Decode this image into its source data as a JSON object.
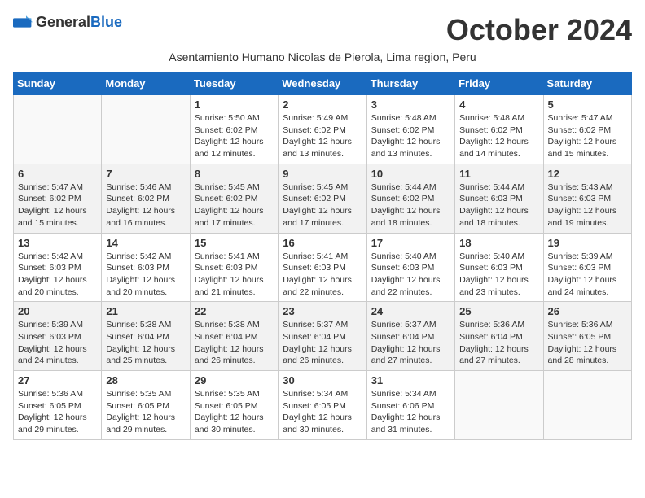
{
  "logo": {
    "general": "General",
    "blue": "Blue"
  },
  "title": "October 2024",
  "subtitle": "Asentamiento Humano Nicolas de Pierola, Lima region, Peru",
  "weekdays": [
    "Sunday",
    "Monday",
    "Tuesday",
    "Wednesday",
    "Thursday",
    "Friday",
    "Saturday"
  ],
  "weeks": [
    [
      {
        "day": "",
        "info": ""
      },
      {
        "day": "",
        "info": ""
      },
      {
        "day": "1",
        "info": "Sunrise: 5:50 AM\nSunset: 6:02 PM\nDaylight: 12 hours and 12 minutes."
      },
      {
        "day": "2",
        "info": "Sunrise: 5:49 AM\nSunset: 6:02 PM\nDaylight: 12 hours and 13 minutes."
      },
      {
        "day": "3",
        "info": "Sunrise: 5:48 AM\nSunset: 6:02 PM\nDaylight: 12 hours and 13 minutes."
      },
      {
        "day": "4",
        "info": "Sunrise: 5:48 AM\nSunset: 6:02 PM\nDaylight: 12 hours and 14 minutes."
      },
      {
        "day": "5",
        "info": "Sunrise: 5:47 AM\nSunset: 6:02 PM\nDaylight: 12 hours and 15 minutes."
      }
    ],
    [
      {
        "day": "6",
        "info": "Sunrise: 5:47 AM\nSunset: 6:02 PM\nDaylight: 12 hours and 15 minutes."
      },
      {
        "day": "7",
        "info": "Sunrise: 5:46 AM\nSunset: 6:02 PM\nDaylight: 12 hours and 16 minutes."
      },
      {
        "day": "8",
        "info": "Sunrise: 5:45 AM\nSunset: 6:02 PM\nDaylight: 12 hours and 17 minutes."
      },
      {
        "day": "9",
        "info": "Sunrise: 5:45 AM\nSunset: 6:02 PM\nDaylight: 12 hours and 17 minutes."
      },
      {
        "day": "10",
        "info": "Sunrise: 5:44 AM\nSunset: 6:02 PM\nDaylight: 12 hours and 18 minutes."
      },
      {
        "day": "11",
        "info": "Sunrise: 5:44 AM\nSunset: 6:03 PM\nDaylight: 12 hours and 18 minutes."
      },
      {
        "day": "12",
        "info": "Sunrise: 5:43 AM\nSunset: 6:03 PM\nDaylight: 12 hours and 19 minutes."
      }
    ],
    [
      {
        "day": "13",
        "info": "Sunrise: 5:42 AM\nSunset: 6:03 PM\nDaylight: 12 hours and 20 minutes."
      },
      {
        "day": "14",
        "info": "Sunrise: 5:42 AM\nSunset: 6:03 PM\nDaylight: 12 hours and 20 minutes."
      },
      {
        "day": "15",
        "info": "Sunrise: 5:41 AM\nSunset: 6:03 PM\nDaylight: 12 hours and 21 minutes."
      },
      {
        "day": "16",
        "info": "Sunrise: 5:41 AM\nSunset: 6:03 PM\nDaylight: 12 hours and 22 minutes."
      },
      {
        "day": "17",
        "info": "Sunrise: 5:40 AM\nSunset: 6:03 PM\nDaylight: 12 hours and 22 minutes."
      },
      {
        "day": "18",
        "info": "Sunrise: 5:40 AM\nSunset: 6:03 PM\nDaylight: 12 hours and 23 minutes."
      },
      {
        "day": "19",
        "info": "Sunrise: 5:39 AM\nSunset: 6:03 PM\nDaylight: 12 hours and 24 minutes."
      }
    ],
    [
      {
        "day": "20",
        "info": "Sunrise: 5:39 AM\nSunset: 6:03 PM\nDaylight: 12 hours and 24 minutes."
      },
      {
        "day": "21",
        "info": "Sunrise: 5:38 AM\nSunset: 6:04 PM\nDaylight: 12 hours and 25 minutes."
      },
      {
        "day": "22",
        "info": "Sunrise: 5:38 AM\nSunset: 6:04 PM\nDaylight: 12 hours and 26 minutes."
      },
      {
        "day": "23",
        "info": "Sunrise: 5:37 AM\nSunset: 6:04 PM\nDaylight: 12 hours and 26 minutes."
      },
      {
        "day": "24",
        "info": "Sunrise: 5:37 AM\nSunset: 6:04 PM\nDaylight: 12 hours and 27 minutes."
      },
      {
        "day": "25",
        "info": "Sunrise: 5:36 AM\nSunset: 6:04 PM\nDaylight: 12 hours and 27 minutes."
      },
      {
        "day": "26",
        "info": "Sunrise: 5:36 AM\nSunset: 6:05 PM\nDaylight: 12 hours and 28 minutes."
      }
    ],
    [
      {
        "day": "27",
        "info": "Sunrise: 5:36 AM\nSunset: 6:05 PM\nDaylight: 12 hours and 29 minutes."
      },
      {
        "day": "28",
        "info": "Sunrise: 5:35 AM\nSunset: 6:05 PM\nDaylight: 12 hours and 29 minutes."
      },
      {
        "day": "29",
        "info": "Sunrise: 5:35 AM\nSunset: 6:05 PM\nDaylight: 12 hours and 30 minutes."
      },
      {
        "day": "30",
        "info": "Sunrise: 5:34 AM\nSunset: 6:05 PM\nDaylight: 12 hours and 30 minutes."
      },
      {
        "day": "31",
        "info": "Sunrise: 5:34 AM\nSunset: 6:06 PM\nDaylight: 12 hours and 31 minutes."
      },
      {
        "day": "",
        "info": ""
      },
      {
        "day": "",
        "info": ""
      }
    ]
  ]
}
